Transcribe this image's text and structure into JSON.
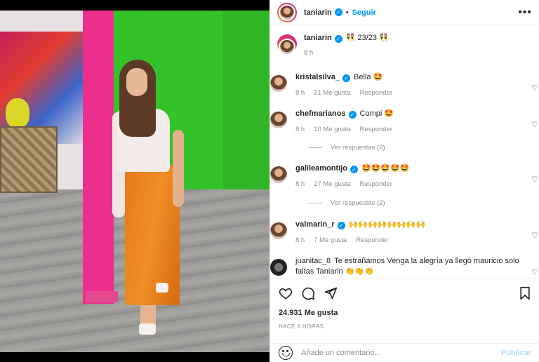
{
  "post": {
    "username": "taniarin",
    "follow_label": "Seguir",
    "separator": "•",
    "more_label": "•••",
    "caption": "👯 23/23 👯",
    "caption_time": "8 h",
    "likes": "24.931 Me gusta",
    "time_ago": "HACE 8 HORAS"
  },
  "comments": [
    {
      "user": "kristalsilva_",
      "verified": true,
      "text": "Bella 🤩",
      "time": "8 h",
      "likes": "21 Me gusta",
      "reply": "Responder"
    },
    {
      "user": "chefmarianos",
      "verified": true,
      "text": "Compi 🤩",
      "time": "8 h",
      "likes": "10 Me gusta",
      "reply": "Responder"
    },
    {
      "user": "galileamontijo",
      "verified": true,
      "text": "🤩🤩🤩🤩🤩",
      "time": "8 h",
      "likes": "27 Me gusta",
      "reply": "Responder"
    },
    {
      "user": "valmarin_r",
      "verified": true,
      "text": "🙌🙌🙌🙌🙌🙌🙌🙌",
      "time": "8 h",
      "likes": "7 Me gusta",
      "reply": "Responder"
    },
    {
      "user": "juanitac_8",
      "verified": false,
      "text": "Te estrañamos Venga la alegría ya llegó mauricio solo faltas Taniarin 👏👏👏",
      "time": "",
      "likes": "",
      "reply": ""
    }
  ],
  "view_replies": [
    "Ver respuestas (2)",
    "Ver respuestas (2)"
  ],
  "add_comment": {
    "placeholder": "Añade un comentario...",
    "publish_label": "Publicar"
  },
  "icons": {
    "like": "heart-icon",
    "comment": "comment-icon",
    "share": "share-icon",
    "save": "bookmark-icon",
    "emoji": "emoji-icon",
    "more": "more-options-icon",
    "verified": "verified-badge-icon"
  },
  "colors": {
    "accent": "#0095f6",
    "muted": "#8e8e8e",
    "text": "#262626",
    "publish_disabled": "#b2dffc"
  }
}
